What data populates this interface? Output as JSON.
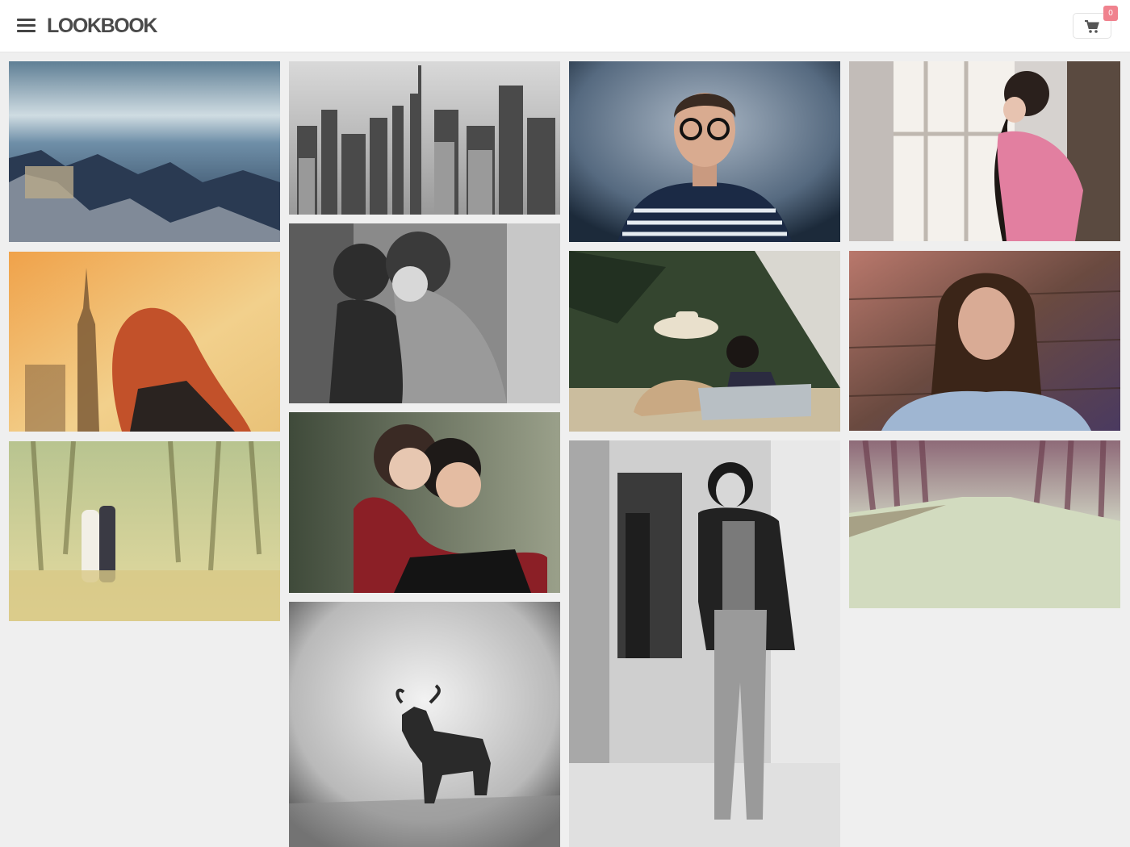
{
  "header": {
    "brand": "LOOKBOOK",
    "cart_count": "0",
    "menu_icon": "hamburger-menu-icon",
    "cart_icon": "shopping-cart-icon"
  },
  "colors": {
    "header_bg": "#ffffff",
    "page_bg": "#efefef",
    "badge": "#f0828e",
    "logo": "#4a4a4a"
  },
  "gallery": {
    "columns": 4,
    "photos": [
      {
        "subject": "city-rooftops-photo"
      },
      {
        "subject": "new-york-skyline-photo"
      },
      {
        "subject": "man-with-glasses-photo"
      },
      {
        "subject": "woman-at-window-photo"
      },
      {
        "subject": "woman-sunset-skyline-photo"
      },
      {
        "subject": "couple-embrace-bw-photo"
      },
      {
        "subject": "couple-picnic-cowboy-hat-photo"
      },
      {
        "subject": "woman-portrait-photo"
      },
      {
        "subject": "couple-in-meadow-photo"
      },
      {
        "subject": "couple-hug-photo"
      },
      {
        "subject": "woman-leather-jacket-photo"
      },
      {
        "subject": "forest-road-photo"
      },
      {
        "subject": "wildebeest-photo"
      }
    ]
  }
}
